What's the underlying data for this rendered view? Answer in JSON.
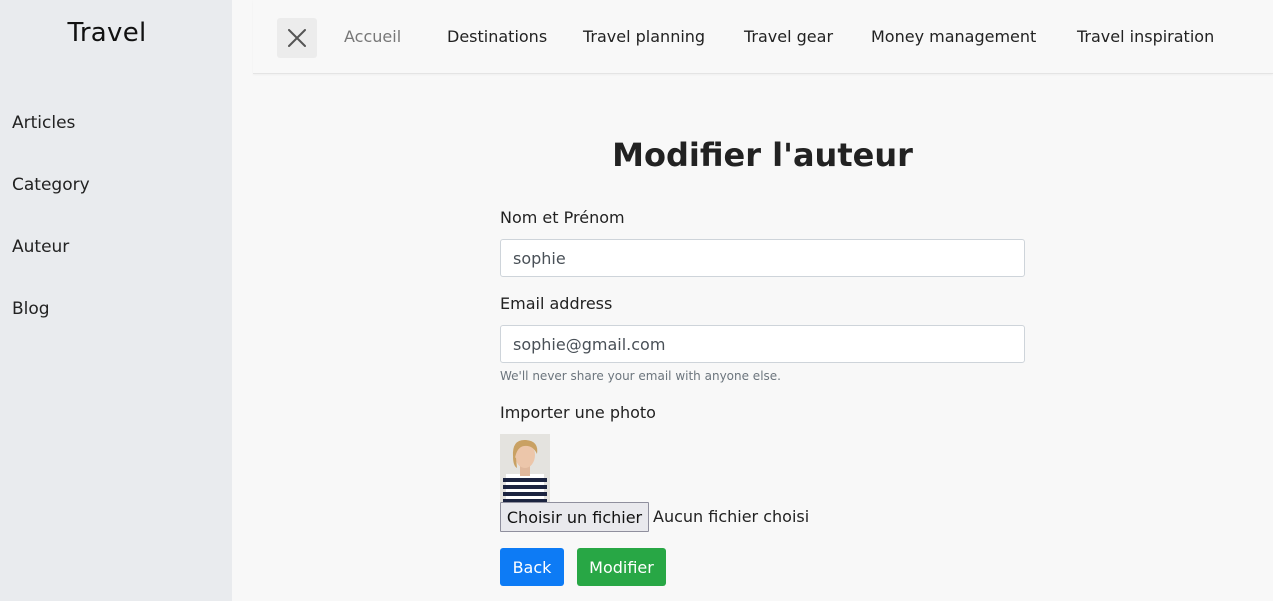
{
  "sidebar": {
    "brand": "Travel",
    "items": [
      {
        "label": "Articles"
      },
      {
        "label": "Category"
      },
      {
        "label": "Auteur"
      },
      {
        "label": "Blog"
      }
    ]
  },
  "topnav": {
    "close_icon": "close-icon",
    "links": [
      {
        "label": "Accueil"
      },
      {
        "label": "Destinations"
      },
      {
        "label": "Travel planning"
      },
      {
        "label": "Travel gear"
      },
      {
        "label": "Money management"
      },
      {
        "label": "Travel inspiration"
      }
    ]
  },
  "form": {
    "title": "Modifier l'auteur",
    "name_label": "Nom et Prénom",
    "name_value": "sophie",
    "email_label": "Email address",
    "email_value": "sophie@gmail.com",
    "email_help": "We'll never share your email with anyone else.",
    "photo_label": "Importer une photo",
    "file_button": "Choisir un fichier",
    "file_status": "Aucun fichier choisi",
    "back_button": "Back",
    "submit_button": "Modifier"
  },
  "colors": {
    "primary": "#0d7bf5",
    "success": "#28a745",
    "sidebar_bg": "#e9ebee"
  }
}
